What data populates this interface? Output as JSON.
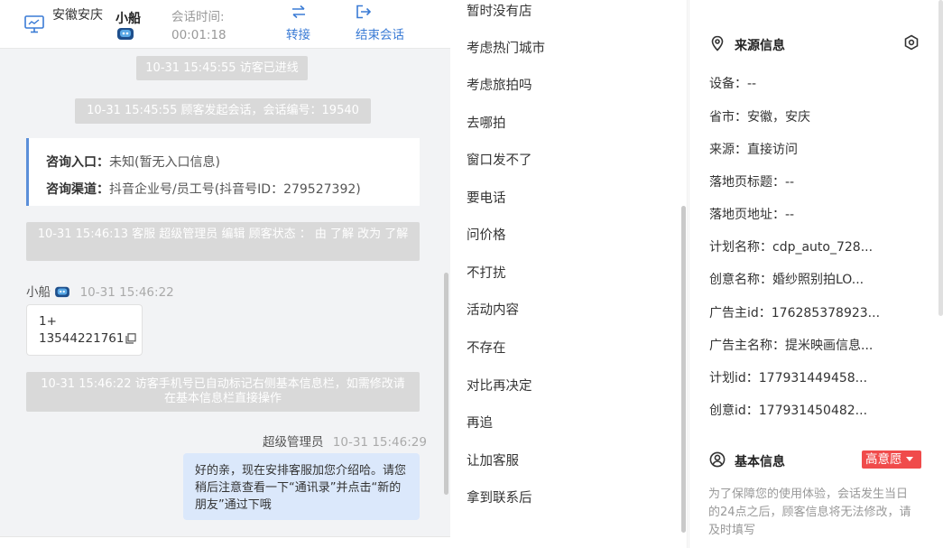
{
  "header": {
    "location": "安徽安庆",
    "visitor_name": "小船",
    "session_time_label": "会话时间:",
    "session_time_value": "00:01:18",
    "transfer_label": "转接",
    "end_session_label": "结束会话"
  },
  "chat": {
    "sys1": "10-31 15:45:55 访客已进线",
    "sys2": "10-31 15:45:55 顾客发起会话，会话编号：19540",
    "entry_label": "咨询入口：",
    "entry_value": "未知(暂无入口信息)",
    "channel_label": "咨询渠道：",
    "channel_value": "抖音企业号/员工号(抖音号ID：279527392)",
    "sys3": "10-31 15:46:13 客服 超级管理员 编辑 顾客状态 ： 由 了解 改为 了解",
    "msg1_sender": "小船",
    "msg1_time": "10-31 15:46:22",
    "msg1_line1": "1+",
    "msg1_line2": "13544221761",
    "sys4": "10-31 15:46:22 访客手机号已自动标记右侧基本信息栏，如需修改请在基本信息栏直接操作",
    "msg2_sender": "超级管理员",
    "msg2_time": "10-31 15:46:29",
    "msg2_text": "好的亲，现在安排客服加您介绍哈。请您稍后注意查看一下“通讯录”并点击“新的朋友”通过下哦"
  },
  "quick_replies": [
    "暂时没有店",
    "考虑热门城市",
    "考虑旅拍吗",
    "去哪拍",
    "窗口发不了",
    "要电话",
    "问价格",
    "不打扰",
    "活动内容",
    "不存在",
    "对比再决定",
    "再追",
    "让加客服",
    "拿到联系后"
  ],
  "source_info": {
    "title": "来源信息",
    "device": "设备：--",
    "province": "省市：安徽，安庆",
    "source": "来源：直接访问",
    "landing_title": "落地页标题：--",
    "landing_url": "落地页地址：--",
    "plan_name": "计划名称：cdp_auto_728...",
    "creative_name": "创意名称：婚纱照别拍LO...",
    "advertiser_id": "广告主id：176285378923...",
    "advertiser_name": "广告主名称：提米映画信息...",
    "plan_id": "计划id：177931449458...",
    "creative_id": "创意id：177931450482..."
  },
  "basic_info": {
    "title": "基本信息",
    "intent_badge": "高意愿",
    "note": "为了保障您的使用体验，会话发生当日的24点之后，顾客信息将无法修改，请及时填写"
  },
  "colors": {
    "accent": "#3a7bd5",
    "badge": "#f04b4b",
    "user_bubble": "#dbe8fb"
  }
}
